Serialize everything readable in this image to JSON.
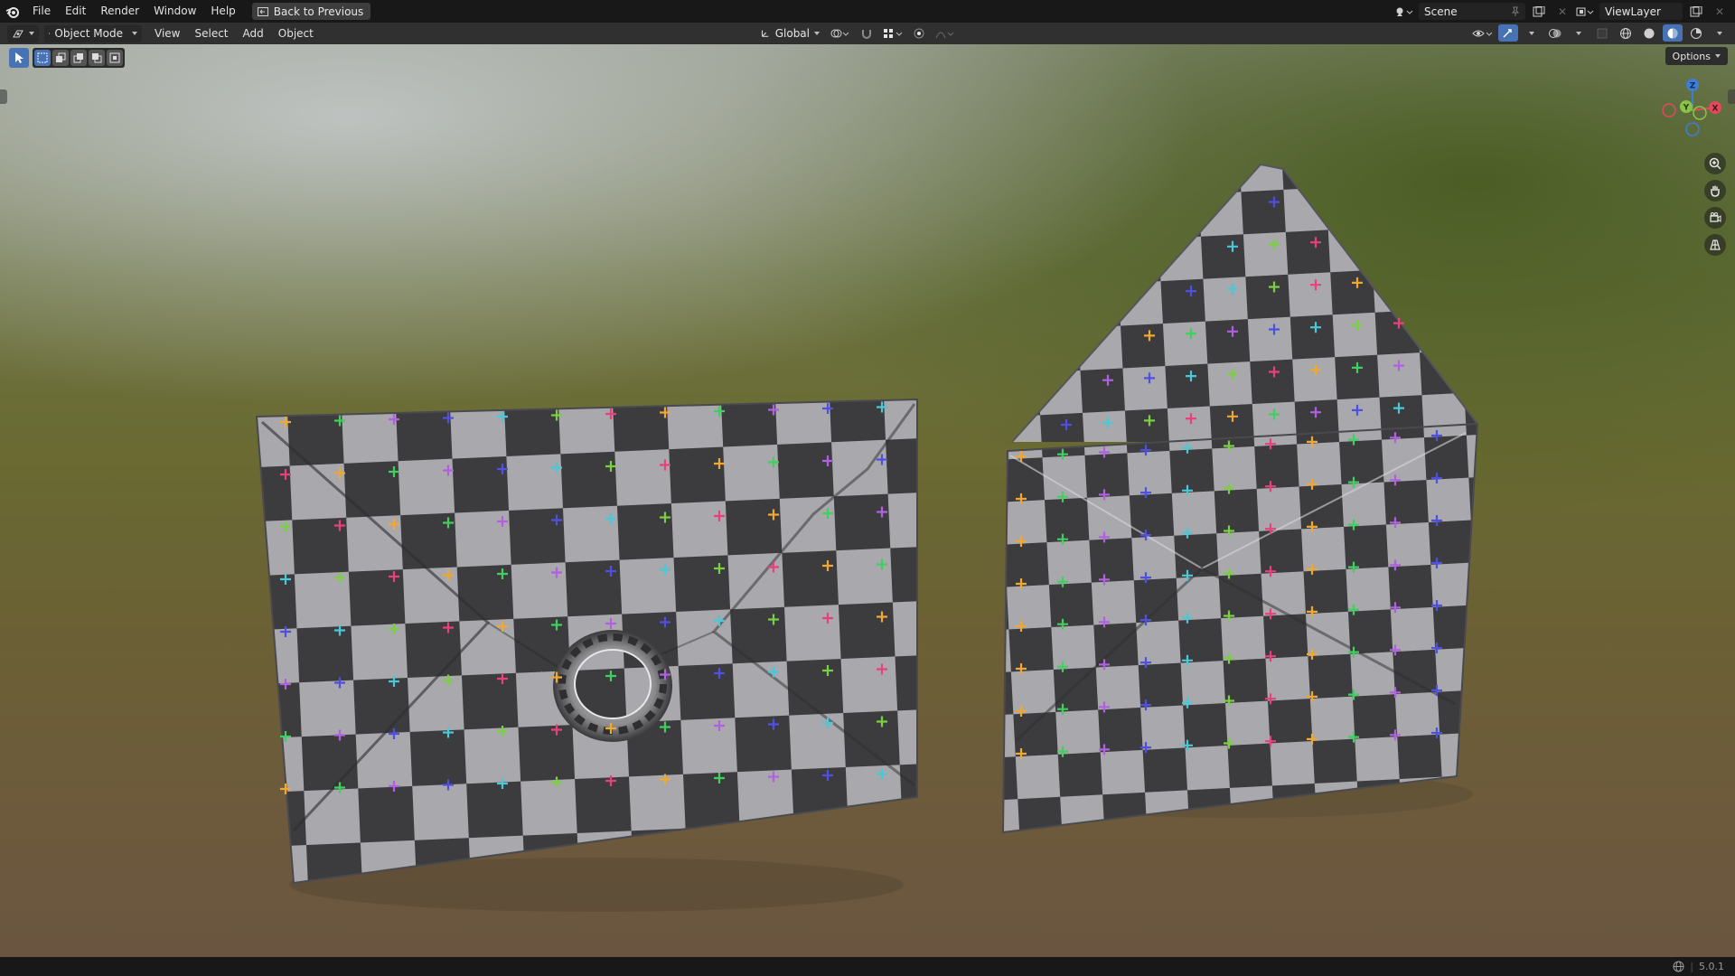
{
  "topbar": {
    "menus": [
      "File",
      "Edit",
      "Render",
      "Window",
      "Help"
    ],
    "back_button": "Back to Previous",
    "scene_label": "Scene",
    "view_layer_label": "ViewLayer"
  },
  "header": {
    "mode": "Object Mode",
    "menus": [
      "View",
      "Select",
      "Add",
      "Object"
    ],
    "orientation": "Global"
  },
  "viewport": {
    "options_label": "Options",
    "gizmo_axes": [
      "Z",
      "Y",
      "X"
    ],
    "axis_colors": {
      "x": "#e04a5a",
      "y": "#8bc34a",
      "z": "#3d7fd6"
    }
  },
  "statusbar": {
    "version": "5.0.1"
  },
  "colors": {
    "accent": "#4772b3",
    "checker_light": "#a9a8ad",
    "checker_dark": "#3c3c3f"
  },
  "checker_cross_colors": [
    "#f0a830",
    "#e8407a",
    "#7ad040",
    "#48c8d8",
    "#5050e0",
    "#b060e0",
    "#40d060"
  ]
}
